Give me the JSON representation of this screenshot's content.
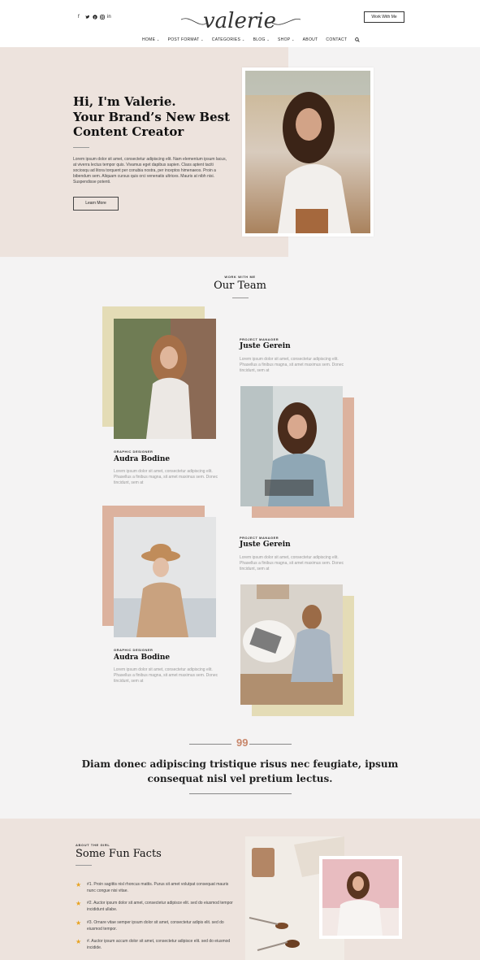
{
  "header": {
    "logo_text": "valerie",
    "social_icons": [
      "f",
      "t",
      "p",
      "i",
      "in"
    ],
    "cta_label": "Work With Me"
  },
  "nav": [
    {
      "label": "HOME",
      "dropdown": true
    },
    {
      "label": "POST FORMAT",
      "dropdown": true
    },
    {
      "label": "CATEGORIES",
      "dropdown": true
    },
    {
      "label": "BLOG",
      "dropdown": true
    },
    {
      "label": "SHOP",
      "dropdown": true
    },
    {
      "label": "ABOUT",
      "dropdown": false
    },
    {
      "label": "CONTACT",
      "dropdown": false
    }
  ],
  "hero": {
    "title_line1": "Hi, I'm Valerie.",
    "title_line2": "Your Brand’s New Best",
    "title_line3": "Content Creator",
    "body": "Lorem ipsum dolor sit amet, consectetur adipiscing elit. Nam elementum ipsum lacus, at viverra lectus tempor quis. Vivamus eget dapibus sapien. Class aptent taciti sociosqu ad litora torquent per conubia nostra, per inceptos himenaeos. Proin a bibendum sem. Aliquam cursus quis orci venenatis ultrices. Mauris at nibh nisi. Suspendisse potenti.",
    "button_label": "Learn More"
  },
  "team": {
    "eyebrow": "WORK WITH ME",
    "title": "Our Team",
    "members": [
      {
        "role": "PROJECT MANAGER",
        "name": "Juste Gerein",
        "desc": "Lorem ipsum dolor sit amet, consectetur adipiscing elit. Phasellus a finibus magna, sit amet maximus sem. Donec tincidunt, sem at"
      },
      {
        "role": "GRAPHIC DESIGNER",
        "name": "Audra Bodine",
        "desc": "Lorem ipsum dolor sit amet, consectetur adipiscing elit. Phasellus a finibus magna, sit amet maximus sem. Donec tincidunt, sem at"
      },
      {
        "role": "PROJECT MANAGER",
        "name": "Juste Gerein",
        "desc": "Lorem ipsum dolor sit amet, consectetur adipiscing elit. Phasellus a finibus magna, sit amet maximus sem. Donec tincidunt, sem at"
      },
      {
        "role": "GRAPHIC DESIGNER",
        "name": "Audra Bodine",
        "desc": "Lorem ipsum dolor sit amet, consectetur adipiscing elit. Phasellus a finibus magna, sit amet maximus sem. Donec tincidunt, sem at"
      }
    ]
  },
  "quote": {
    "mark": "99",
    "line1": "Diam donec adipiscing tristique risus nec feugiate, ipsum",
    "line2": "consequat nisl vel pretium lectus."
  },
  "facts": {
    "eyebrow": "ABOUT THE GIRL",
    "title": "Some Fun Facts",
    "items": [
      "#1. Proin sagittis nisl rhoncus mattis. Purus sit amet volutpat consequat mauris nunc congue nisi vitae.",
      "#2. Auctor ipsum dolor sit amet, consectetur adipisce elit. sed do eiusmod tempor incididunt ullabe.",
      "#3. Ornare vitae semper ipsum dolor sit amet, consectetur adipis elit. sed do eiusmod tempor.",
      "#. Auctor ipsum accum dolor sit amet, consectetur adipisce elit. sed do eiusmod incidide."
    ]
  },
  "colors": {
    "blush": "#ede3dd",
    "sand": "#e4dcb6",
    "terracotta": "#dcb29e",
    "star": "#e8a321",
    "quote_mark": "#c8876b"
  }
}
